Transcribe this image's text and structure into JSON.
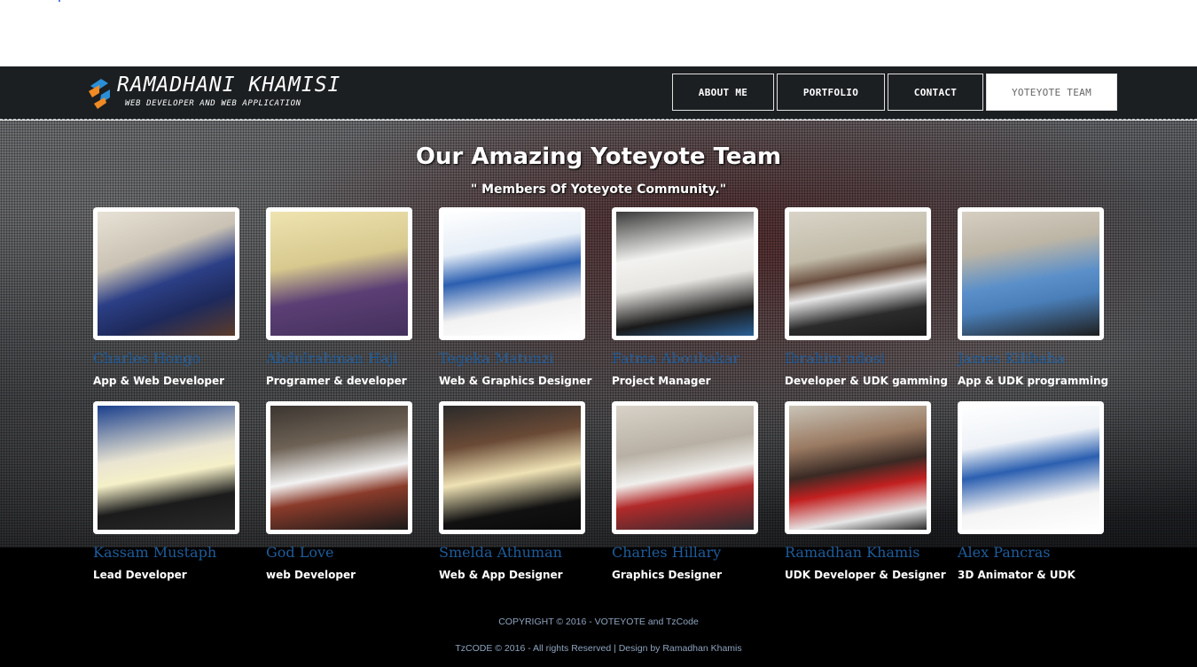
{
  "site": {
    "logo_title": "RAMADHANI KHAMISI",
    "logo_subtitle": "WEB DEVELOPER AND WEB APPLICATION"
  },
  "nav": [
    {
      "label": "ABOUT ME",
      "active": false
    },
    {
      "label": "PORTFOLIO",
      "active": false
    },
    {
      "label": "CONTACT",
      "active": false
    },
    {
      "label": "YOTEYOTE TEAM",
      "active": true
    }
  ],
  "section": {
    "title": "Our Amazing Yoteyote Team",
    "subtitle": "\" Members Of Yoteyote Community.\""
  },
  "members": [
    {
      "name": "Charles Hongo",
      "role": "App & Web Developer"
    },
    {
      "name": "Abdulrahman Haji",
      "role": "Programer & developer"
    },
    {
      "name": "Tegeka Matunzi",
      "role": "Web & Graphics Designer"
    },
    {
      "name": "Fatma Aboubakar",
      "role": "Project Manager"
    },
    {
      "name": "Ibrahim ndosi",
      "role": "Developer & UDK gamming"
    },
    {
      "name": "James Kilibaha",
      "role": "App & UDK programming"
    },
    {
      "name": "Kassam Mustaph",
      "role": "Lead Developer"
    },
    {
      "name": "God Love",
      "role": "web Developer"
    },
    {
      "name": "Smelda Athuman",
      "role": "Web & App Designer"
    },
    {
      "name": "Charles Hillary",
      "role": "Graphics Designer"
    },
    {
      "name": "Ramadhan Khamis",
      "role": "UDK Developer & Designer"
    },
    {
      "name": "Alex Pancras",
      "role": "3D Animator & UDK"
    }
  ],
  "footer": {
    "copyright": "COPYRIGHT © 2016 - VOTEYOTE and TzCode",
    "credits": "TzCODE © 2016 - All rights Reserved | Design by Ramadhan Khamis"
  },
  "colors": {
    "navbar": "#1c1f22",
    "member_name": "#1f5c9a",
    "footer_text": "#8ea4bf",
    "logo_blue": "#2a8fd8",
    "logo_orange": "#f08a24"
  },
  "icons": {
    "logo": "logo-icon"
  }
}
